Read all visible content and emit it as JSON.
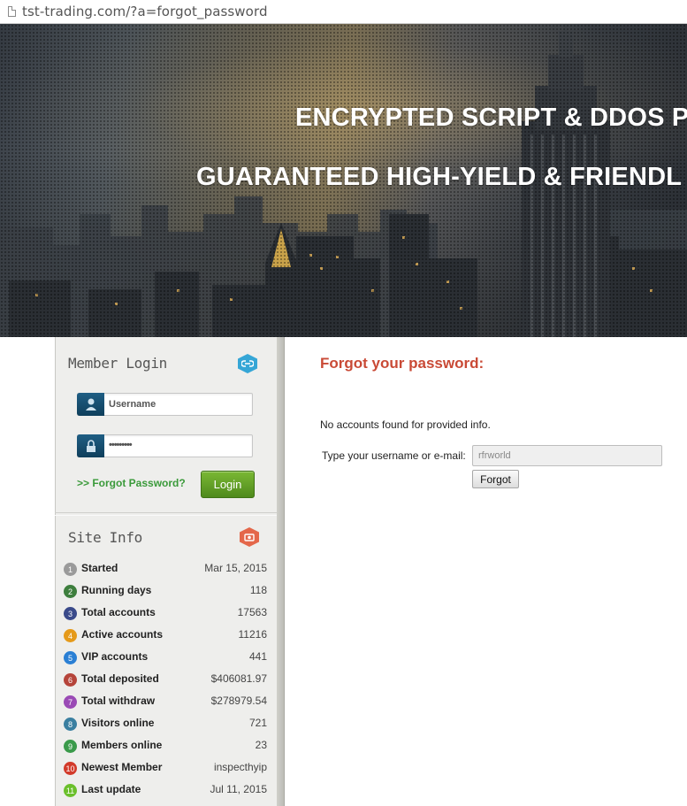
{
  "browser": {
    "url": "tst-trading.com/?a=forgot_password"
  },
  "hero": {
    "line1": "ENCRYPTED SCRIPT & DDOS P",
    "line2": "GUARANTEED HIGH-YIELD & FRIENDL"
  },
  "sidebar": {
    "login": {
      "title": "Member Login",
      "username_value": "Username",
      "password_value": "•••••••••",
      "forgot_link": ">> Forgot Password?",
      "login_button": "Login",
      "icon": "link-icon",
      "icon_color": "#35a6d6"
    },
    "site_info": {
      "title": "Site Info",
      "icon": "camera-icon",
      "icon_color": "#e4674a",
      "items": [
        {
          "num": "1",
          "label": "Started",
          "value": "Mar 15, 2015",
          "color": "#9a9a9a"
        },
        {
          "num": "2",
          "label": "Running days",
          "value": "118",
          "color": "#3d7e3d"
        },
        {
          "num": "3",
          "label": "Total accounts",
          "value": "17563",
          "color": "#3a4a8a"
        },
        {
          "num": "4",
          "label": "Active accounts",
          "value": "11216",
          "color": "#e59a1a"
        },
        {
          "num": "5",
          "label": "VIP accounts",
          "value": "441",
          "color": "#2a7fd4"
        },
        {
          "num": "6",
          "label": "Total deposited",
          "value": "$406081.97",
          "color": "#b5443a"
        },
        {
          "num": "7",
          "label": "Total withdraw",
          "value": "$278979.54",
          "color": "#9a4ab5"
        },
        {
          "num": "8",
          "label": "Visitors online",
          "value": "721",
          "color": "#3a7fa0"
        },
        {
          "num": "9",
          "label": "Members online",
          "value": "23",
          "color": "#3a9a4a"
        },
        {
          "num": "10",
          "label": "Newest Member",
          "value": "inspecthyip",
          "color": "#d23a2a"
        },
        {
          "num": "11",
          "label": "Last update",
          "value": "Jul 11, 2015",
          "color": "#6abf2a"
        }
      ]
    }
  },
  "main": {
    "title": "Forgot your password:",
    "message": "No accounts found for provided info.",
    "form_label": "Type your username or e-mail:",
    "input_value": "rfrworld",
    "submit_label": "Forgot"
  }
}
